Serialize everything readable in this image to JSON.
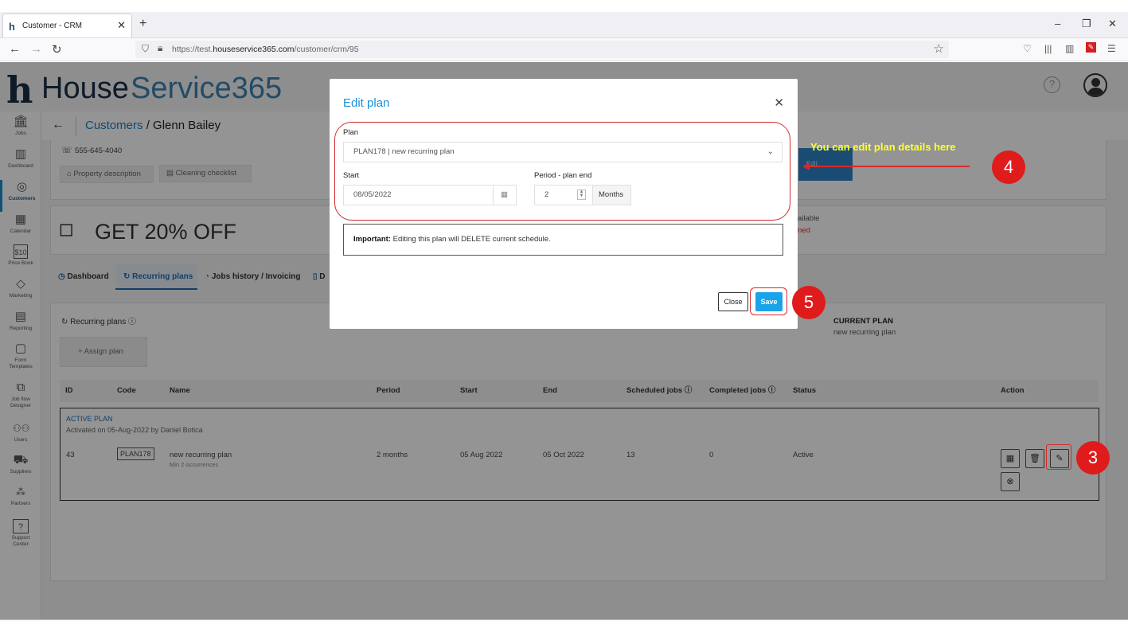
{
  "browser": {
    "tab_title": "Customer - CRM",
    "url_prefix": "https://test.",
    "url_domain": "houseservice365.com",
    "url_path": "/customer/crm/95"
  },
  "app": {
    "logo_word1": "House",
    "logo_word2": "Service365",
    "breadcrumb_link": "Customers",
    "breadcrumb_current": " / Glenn Bailey"
  },
  "sidebar": {
    "items": [
      {
        "label": "Jobs",
        "icon": "bank-icon"
      },
      {
        "label": "Dashboard",
        "icon": "chart-icon"
      },
      {
        "label": "Customers",
        "icon": "target-icon"
      },
      {
        "label": "Calendar",
        "icon": "calendar-icon"
      },
      {
        "label": "Price Book",
        "icon": "price-icon"
      },
      {
        "label": "Marketing",
        "icon": "tag-icon"
      },
      {
        "label": "Reporting",
        "icon": "report-icon"
      },
      {
        "label": "Form Templates",
        "icon": "form-icon"
      },
      {
        "label": "Job flow Designer",
        "icon": "flow-icon"
      },
      {
        "label": "Users",
        "icon": "users-icon"
      },
      {
        "label": "Suppliers",
        "icon": "truck-icon"
      },
      {
        "label": "Partners",
        "icon": "partners-icon"
      },
      {
        "label": "Support Center",
        "icon": "support-icon"
      }
    ]
  },
  "customer": {
    "phone": "555-645-4040",
    "property_btn": "Property description",
    "checklist_btn": "Cleaning checklist",
    "promo": "GET 20% OFF",
    "side_text1": "ailable",
    "side_text2": "ned"
  },
  "tabs": [
    "Dashboard",
    "Recurring plans",
    "Jobs history / Invoicing",
    "D"
  ],
  "recurring": {
    "title": "Recurring plans",
    "assign_btn": "Assign plan",
    "current_plan_label": "CURRENT PLAN",
    "current_plan_name": "new recurring plan",
    "columns": [
      "ID",
      "Code",
      "Name",
      "Period",
      "Start",
      "End",
      "Scheduled jobs",
      "Completed jobs",
      "Status",
      "Action"
    ],
    "active_label": "ACTIVE PLAN",
    "activated_text": "Activated on 05-Aug-2022 by Daniel Botica",
    "row": {
      "id": "43",
      "code": "PLAN178",
      "name": "new recurring plan",
      "name_sub": "Min 2 occurrences",
      "period": "2 months",
      "start": "05 Aug 2022",
      "end": "05 Oct 2022",
      "scheduled": "13",
      "completed": "0",
      "status": "Active"
    }
  },
  "modal": {
    "title": "Edit plan",
    "plan_label": "Plan",
    "plan_value": "PLAN178 | new recurring plan",
    "start_label": "Start",
    "start_value": "08/05/2022",
    "period_label": "Period - plan end",
    "period_value": "2",
    "period_unit": "Months",
    "notice_bold": "Important:",
    "notice_text": " Editing this plan will DELETE current schedule.",
    "close_btn": "Close",
    "save_btn": "Save"
  },
  "annotations": {
    "hint": "You can edit plan details here",
    "edit_ghost": "Edit",
    "step3": "3",
    "step4": "4",
    "step5": "5"
  },
  "colors": {
    "accent": "#1a8fd8",
    "annotation_red": "#e01b1b",
    "annotation_text": "#ffff2e"
  }
}
